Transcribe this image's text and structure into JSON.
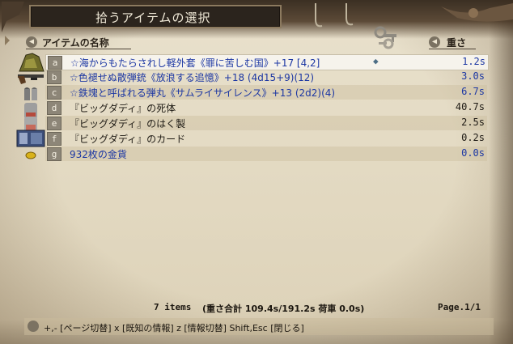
{
  "window": {
    "title": "拾うアイテムの選択"
  },
  "header": {
    "name_col": "アイテムの名称",
    "weight_col": "重さ"
  },
  "items": [
    {
      "key": "a",
      "name": "☆海からもたらされし軽外套《罪に苦しむ国》+17 [4,2]",
      "weight": "1.2s",
      "color": "blue",
      "selected": true,
      "icon": "cloak-icon"
    },
    {
      "key": "b",
      "name": "☆色褪せぬ散弾銃《放浪する追憶》+18 (4d15+9)(12)",
      "weight": "3.0s",
      "color": "blue",
      "selected": false,
      "icon": "shotgun-icon"
    },
    {
      "key": "c",
      "name": "☆鉄塊と呼ばれる弾丸《サムライサイレンス》+13 (2d2)(4)",
      "weight": "6.7s",
      "color": "blue",
      "selected": false,
      "icon": "bullet-icon"
    },
    {
      "key": "d",
      "name": "『ビッグダディ』の死体",
      "weight": "40.7s",
      "color": "black",
      "selected": false,
      "icon": "corpse-icon"
    },
    {
      "key": "e",
      "name": "『ビッグダディ』のはく製",
      "weight": "2.5s",
      "color": "black",
      "selected": false,
      "icon": "figurine-icon"
    },
    {
      "key": "f",
      "name": "『ビッグダディ』のカード",
      "weight": "0.2s",
      "color": "black",
      "selected": false,
      "icon": "card-icon"
    },
    {
      "key": "g",
      "name": "932枚の金貨",
      "weight": "0.0s",
      "color": "blue",
      "selected": false,
      "icon": "gold-coin-icon"
    }
  ],
  "footer": {
    "count": "7 items",
    "weight_summary": "(重さ合計 109.4s/191.2s 荷車 0.0s)",
    "page": "Page.1/1"
  },
  "help": "+,- [ページ切替]  x [既知の情報]  z [情報切替]  Shift,Esc [閉じる]"
}
